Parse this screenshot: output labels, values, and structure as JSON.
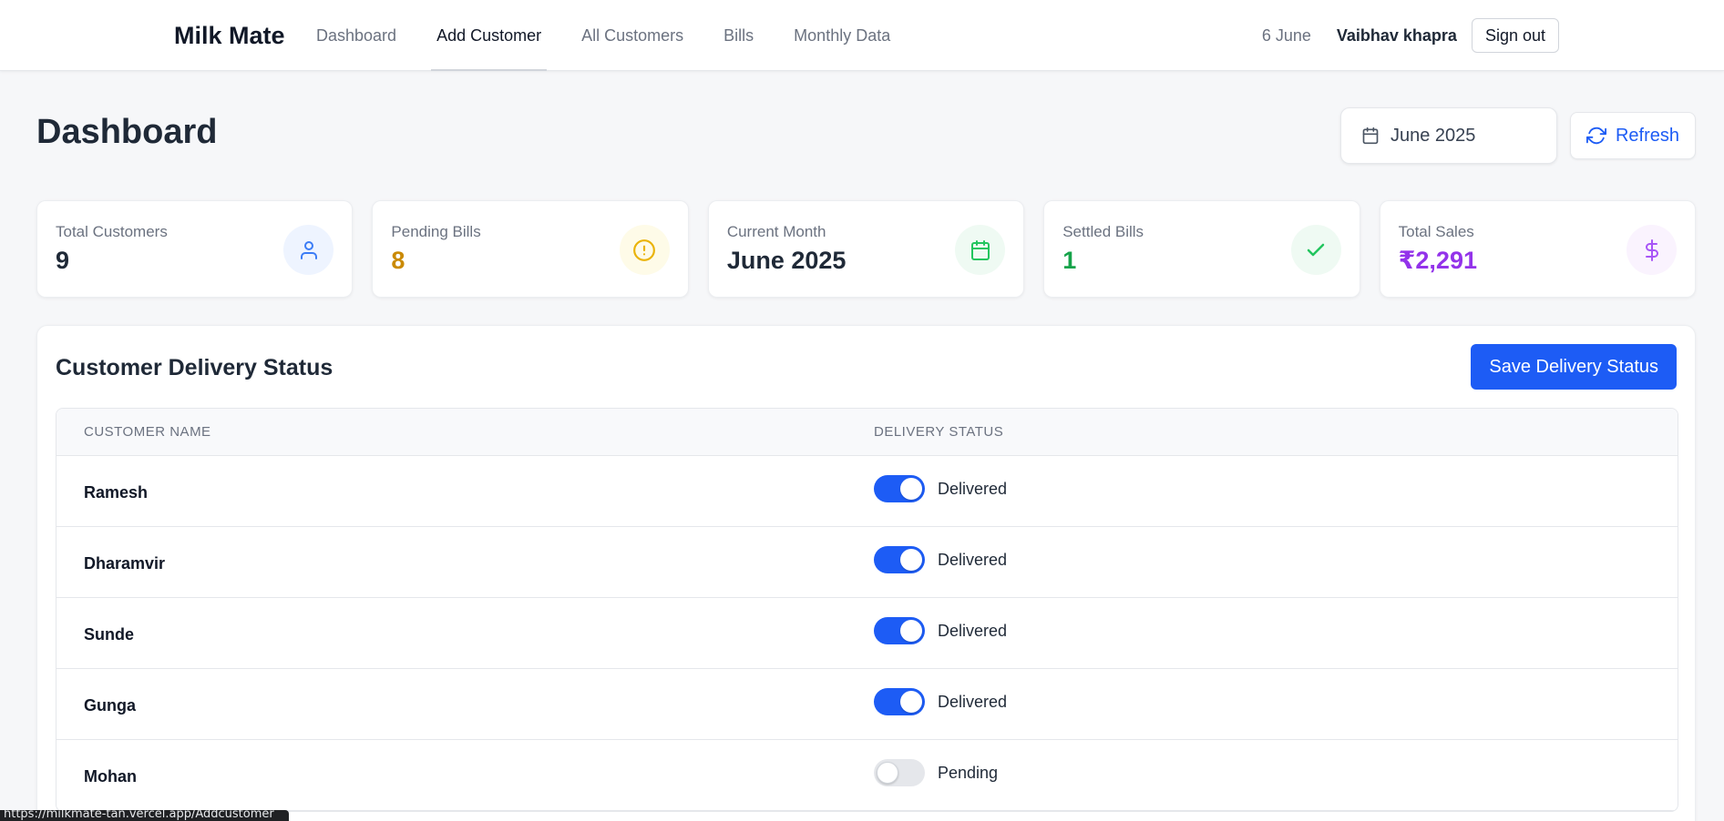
{
  "nav": {
    "brand": "Milk Mate",
    "links": [
      "Dashboard",
      "Add Customer",
      "All Customers",
      "Bills",
      "Monthly Data"
    ],
    "active_index": 1,
    "date": "6 June",
    "user": "Vaibhav khapra",
    "signout_label": "Sign out"
  },
  "header": {
    "title": "Dashboard",
    "month_select": "June 2025",
    "refresh_label": "Refresh"
  },
  "stats": [
    {
      "label": "Total Customers",
      "value": "9",
      "value_color": "#1f2937",
      "icon": "user-icon",
      "icon_bg": "#eef4ff",
      "icon_color": "#3b7cf6"
    },
    {
      "label": "Pending Bills",
      "value": "8",
      "value_color": "#ca8a04",
      "icon": "alert-circle-icon",
      "icon_bg": "#fefbe8",
      "icon_color": "#eab308"
    },
    {
      "label": "Current Month",
      "value": "June 2025",
      "value_color": "#1f2937",
      "icon": "calendar-icon",
      "icon_bg": "#effaf3",
      "icon_color": "#22c55e"
    },
    {
      "label": "Settled Bills",
      "value": "1",
      "value_color": "#16a34a",
      "icon": "check-icon",
      "icon_bg": "#effaf3",
      "icon_color": "#22c55e"
    },
    {
      "label": "Total Sales",
      "value": "₹2,291",
      "value_color": "#9333ea",
      "icon": "dollar-icon",
      "icon_bg": "#faf3fe",
      "icon_color": "#a855f7"
    }
  ],
  "delivery": {
    "title": "Customer Delivery Status",
    "save_label": "Save Delivery Status",
    "col_name": "Customer Name",
    "col_status": "Delivery Status",
    "rows": [
      {
        "name": "Ramesh",
        "status": "Delivered",
        "on": true
      },
      {
        "name": "Dharamvir",
        "status": "Delivered",
        "on": true
      },
      {
        "name": "Sunde",
        "status": "Delivered",
        "on": true
      },
      {
        "name": "Gunga",
        "status": "Delivered",
        "on": true
      },
      {
        "name": "Mohan",
        "status": "Pending",
        "on": false
      }
    ]
  },
  "browser_status_url": "https://milkmate-tan.vercel.app/Addcustomer",
  "colors": {
    "accent": "#1d5cf5"
  }
}
